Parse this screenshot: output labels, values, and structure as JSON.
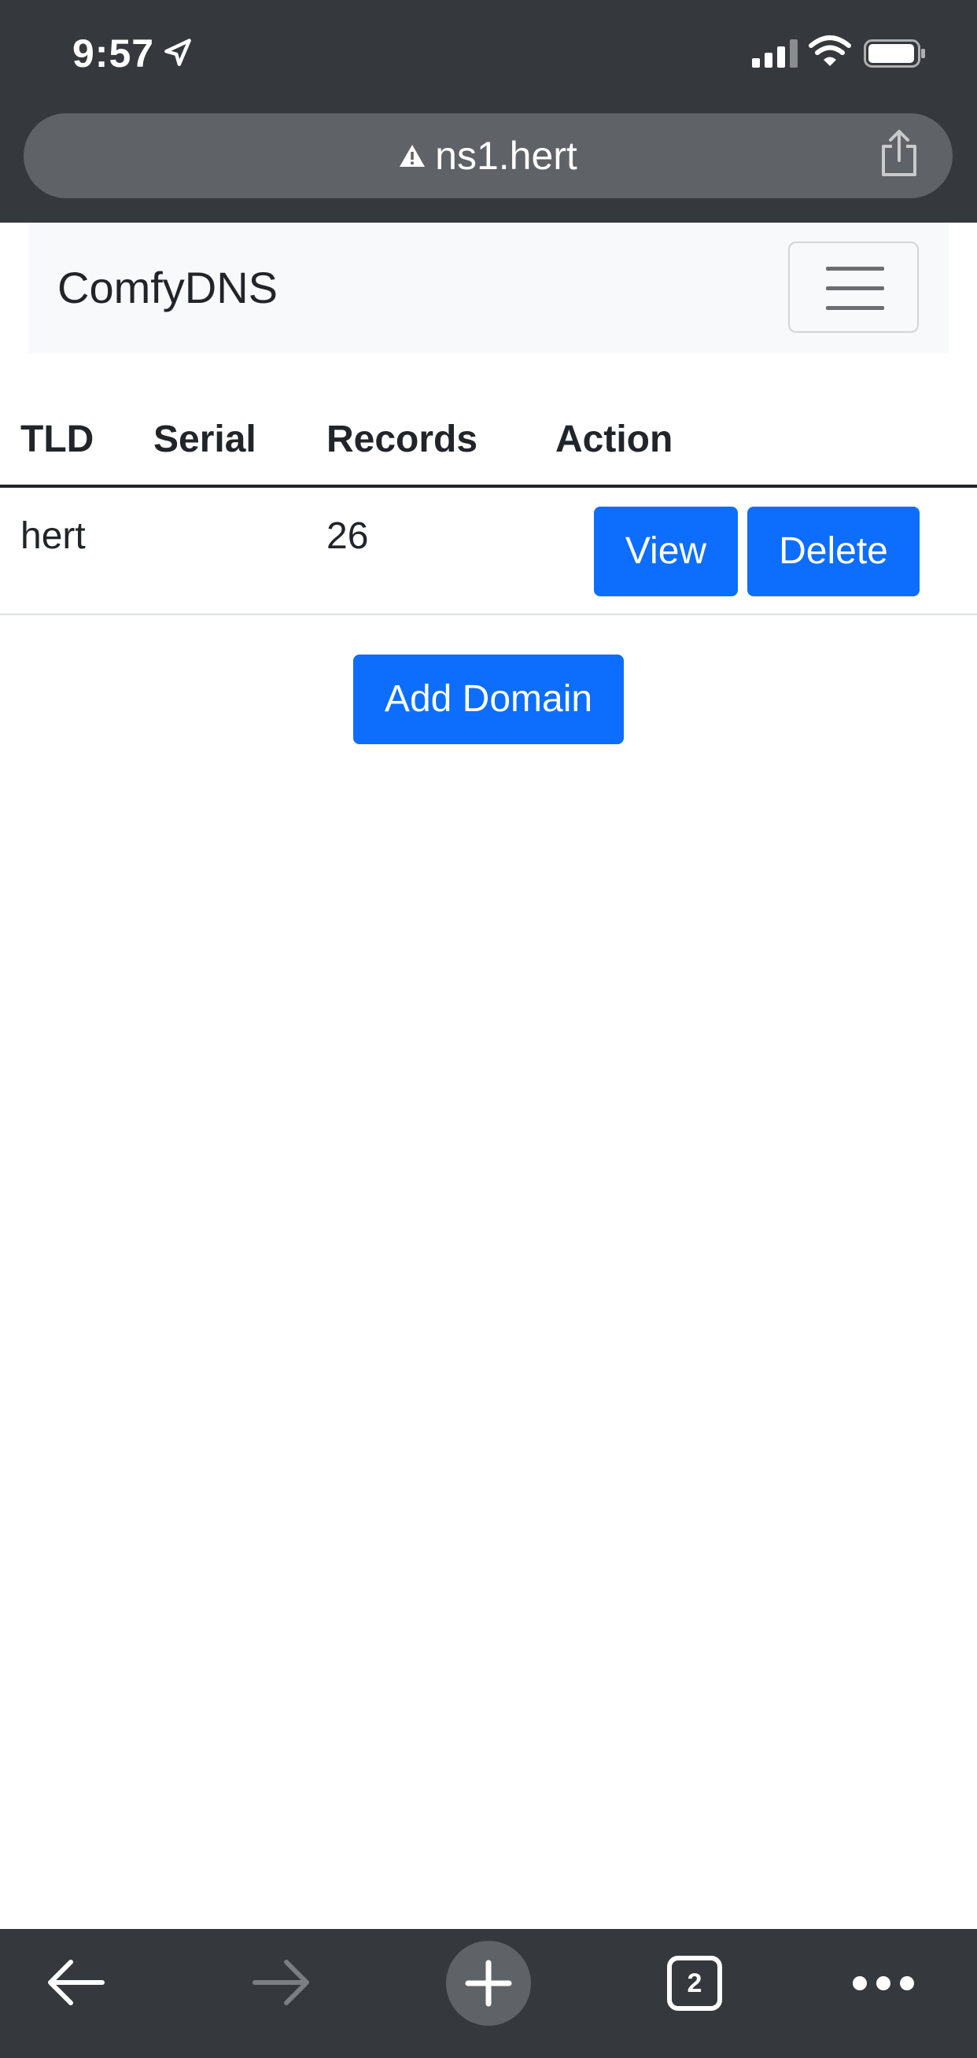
{
  "status_bar": {
    "time": "9:57"
  },
  "browser": {
    "url": "ns1.hert",
    "open_tab_count": "2"
  },
  "navbar": {
    "brand": "ComfyDNS"
  },
  "domains_table": {
    "headers": {
      "tld": "TLD",
      "serial": "Serial",
      "records": "Records",
      "action": "Action"
    },
    "rows": [
      {
        "tld": "hert",
        "serial": "",
        "records": "26",
        "view_label": "View",
        "delete_label": "Delete"
      }
    ]
  },
  "add_domain_label": "Add Domain",
  "colors": {
    "primary_button": "#0d6efd",
    "browser_chrome": "#35383c",
    "navbar_background": "#f8f9fa"
  },
  "icons": {
    "status_bar": [
      "location-arrow-icon",
      "cellular-signal-icon",
      "wifi-icon",
      "battery-icon"
    ],
    "url_bar": [
      "not-secure-warning-icon",
      "share-icon"
    ],
    "navbar": [
      "hamburger-menu-icon"
    ],
    "toolbar": [
      "back-arrow-icon",
      "forward-arrow-icon",
      "new-tab-plus-icon",
      "tab-switcher-icon",
      "more-dots-icon"
    ]
  }
}
